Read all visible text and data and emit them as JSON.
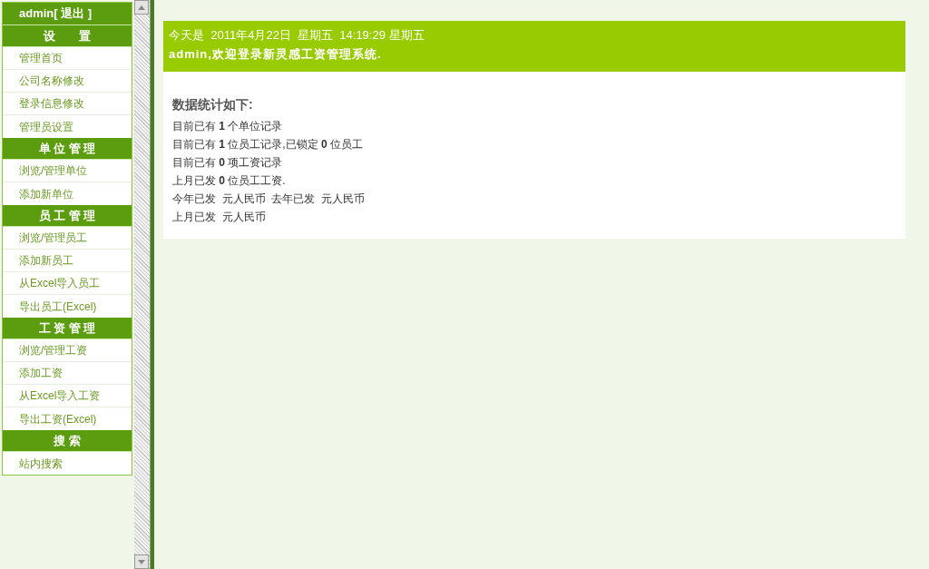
{
  "sidebar": {
    "user": {
      "name": "admin",
      "logout": "[ 退出 ]"
    },
    "sections": [
      {
        "title": "设　　置",
        "items": [
          "管理首页",
          "公司名称修改",
          "登录信息修改",
          "管理员设置"
        ]
      },
      {
        "title": "单 位 管 理",
        "items": [
          "浏览/管理单位",
          "添加新单位"
        ]
      },
      {
        "title": "员 工 管 理",
        "items": [
          "浏览/管理员工",
          "添加新员工",
          "从Excel导入员工",
          "导出员工(Excel)"
        ]
      },
      {
        "title": "工 资 管 理",
        "items": [
          "浏览/管理工资",
          "添加工资",
          "从Excel导入工资",
          "导出工资(Excel)"
        ]
      },
      {
        "title": "搜 索",
        "items": [
          "站内搜索"
        ]
      }
    ]
  },
  "banner": {
    "date": "今天是  2011年4月22日  星期五  14:19:29 星期五",
    "welcome": "admin,欢迎登录新灵感工资管理系统."
  },
  "stats": {
    "title": "数据统计如下:",
    "lines": [
      "目前已有 **1** 个单位记录",
      "目前已有 **1** 位员工记录,已锁定 **0** 位员工",
      "目前已有 **0** 项工资记录",
      "上月已发 **0** 位员工工资.",
      "今年已发  元人民币  去年已发  元人民币",
      "上月已发  元人民币"
    ]
  }
}
